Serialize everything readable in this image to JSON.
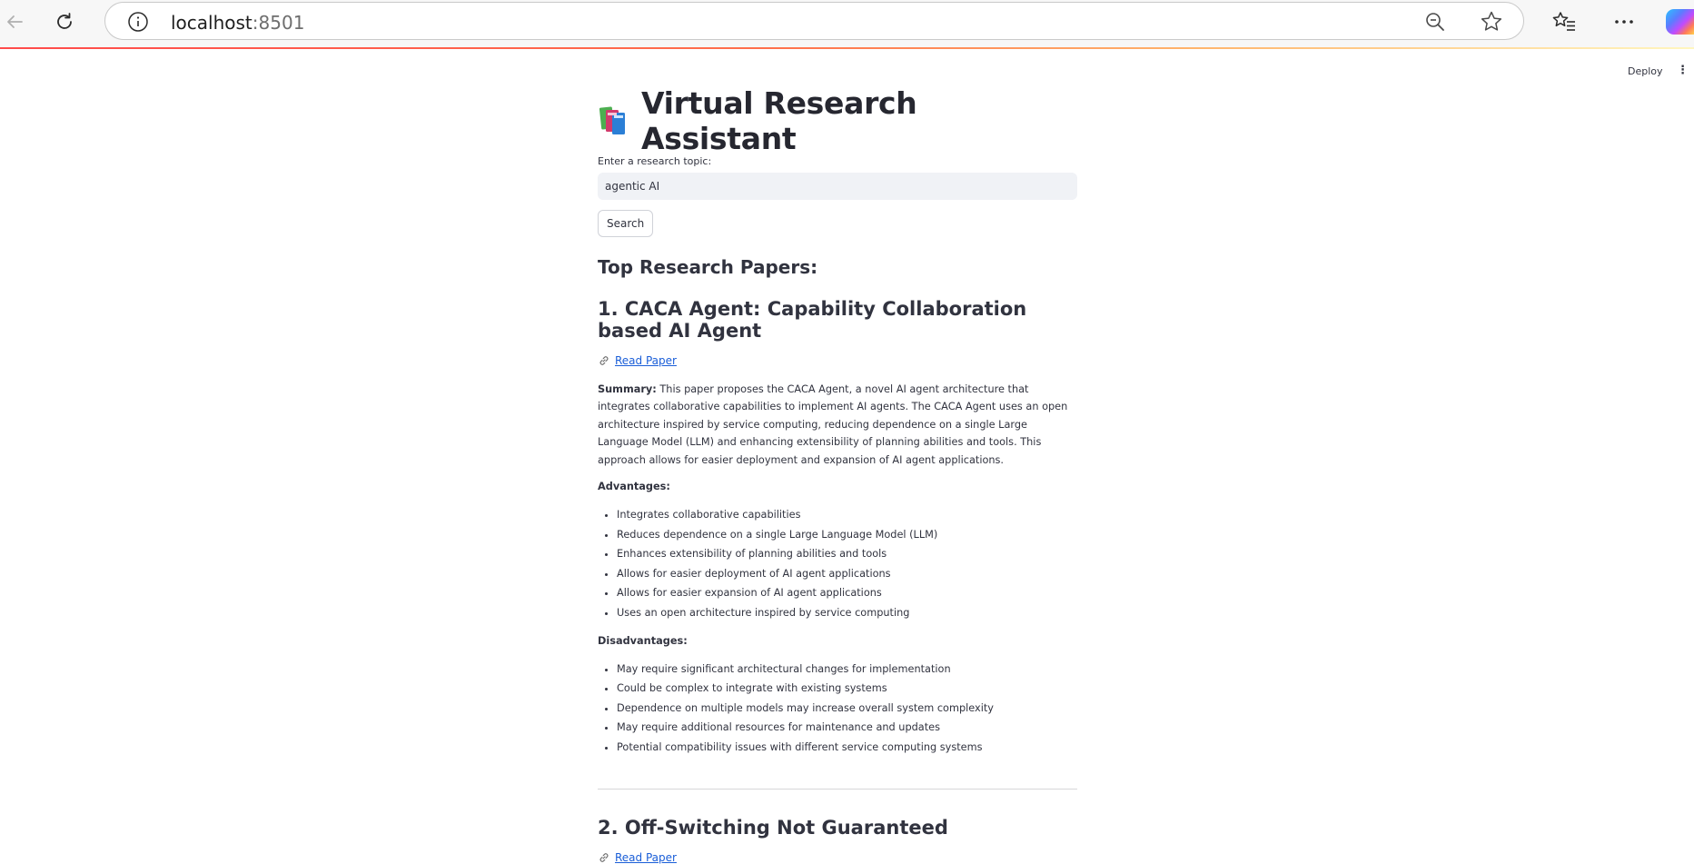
{
  "browser": {
    "address_host": "localhost",
    "address_port": ":8501"
  },
  "app_header": {
    "deploy_label": "Deploy",
    "menu_icon": "⋮"
  },
  "main": {
    "title": "Virtual Research Assistant",
    "input": {
      "label": "Enter a research topic:",
      "value": "agentic AI"
    },
    "search_button_label": "Search",
    "results_heading": "Top Research Papers:"
  },
  "papers": [
    {
      "title": "1. CACA Agent: Capability Collaboration based AI Agent",
      "link_label": "Read Paper",
      "summary_label": "Summary:",
      "summary_text": " This paper proposes the CACA Agent, a novel AI agent architecture that integrates collaborative capabilities to implement AI agents. The CACA Agent uses an open architecture inspired by service computing, reducing dependence on a single Large Language Model (LLM) and enhancing extensibility of planning abilities and tools. This approach allows for easier deployment and expansion of AI agent applications.",
      "advantages_label": "Advantages:",
      "advantages": [
        "Integrates collaborative capabilities",
        "Reduces dependence on a single Large Language Model (LLM)",
        "Enhances extensibility of planning abilities and tools",
        "Allows for easier deployment of AI agent applications",
        "Allows for easier expansion of AI agent applications",
        "Uses an open architecture inspired by service computing"
      ],
      "disadvantages_label": "Disadvantages:",
      "disadvantages": [
        "May require significant architectural changes for implementation",
        "Could be complex to integrate with existing systems",
        "Dependence on multiple models may increase overall system complexity",
        "May require additional resources for maintenance and updates",
        "Potential compatibility issues with different service computing systems"
      ]
    },
    {
      "title": "2. Off-Switching Not Guaranteed",
      "link_label": "Read Paper"
    }
  ],
  "icons": {
    "back": "back-arrow-icon",
    "reload": "reload-icon",
    "site_info": "info-icon",
    "zoom": "zoom-out-icon",
    "favorite": "star-icon",
    "favorites_list": "favorites-icon",
    "more": "more-icon",
    "copilot": "copilot-icon",
    "title": "books-icon",
    "link": "link-icon"
  },
  "colors": {
    "accent": "#ff4b4b",
    "link": "#1a5ed8",
    "input_bg": "#f0f2f6",
    "text": "#31333f"
  }
}
